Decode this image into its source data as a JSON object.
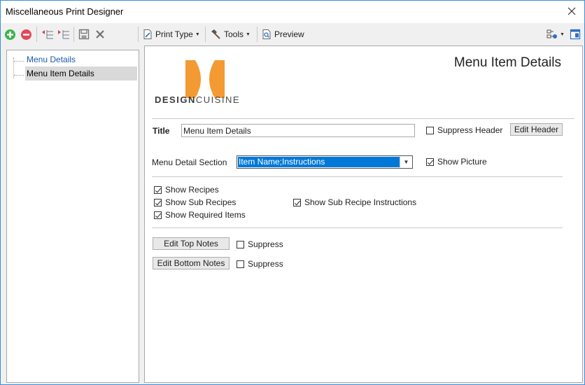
{
  "window": {
    "title": "Miscellaneous Print Designer"
  },
  "toolbar": {
    "print_type_label": "Print Type",
    "tools_label": "Tools",
    "preview_label": "Preview"
  },
  "tree": {
    "items": [
      {
        "label": "Menu Details"
      },
      {
        "label": "Menu Item Details"
      }
    ]
  },
  "logo": {
    "text_bold": "DESIGN",
    "text_regular": "CUISINE",
    "accent_color": "#f39a33"
  },
  "panel": {
    "heading": "Menu Item Details",
    "title_label": "Title",
    "title_value": "Menu Item Details",
    "suppress_header_label": "Suppress Header",
    "suppress_header_checked": false,
    "edit_header_label": "Edit Header",
    "section_label": "Menu Detail Section",
    "section_value": "Item Name;Instructions",
    "show_picture_label": "Show Picture",
    "show_picture_checked": true,
    "show_recipes_label": "Show Recipes",
    "show_sub_recipes_label": "Show Sub Recipes",
    "show_required_items_label": "Show Required Items",
    "show_sub_recipe_instructions_label": "Show Sub Recipe Instructions",
    "edit_top_notes_label": "Edit Top Notes",
    "edit_bottom_notes_label": "Edit Bottom Notes",
    "suppress_label": "Suppress"
  },
  "colors": {
    "selection": "#0078d7",
    "window_border": "#3b8edb",
    "add_icon": "#3cb44a",
    "remove_icon": "#e0495a"
  }
}
